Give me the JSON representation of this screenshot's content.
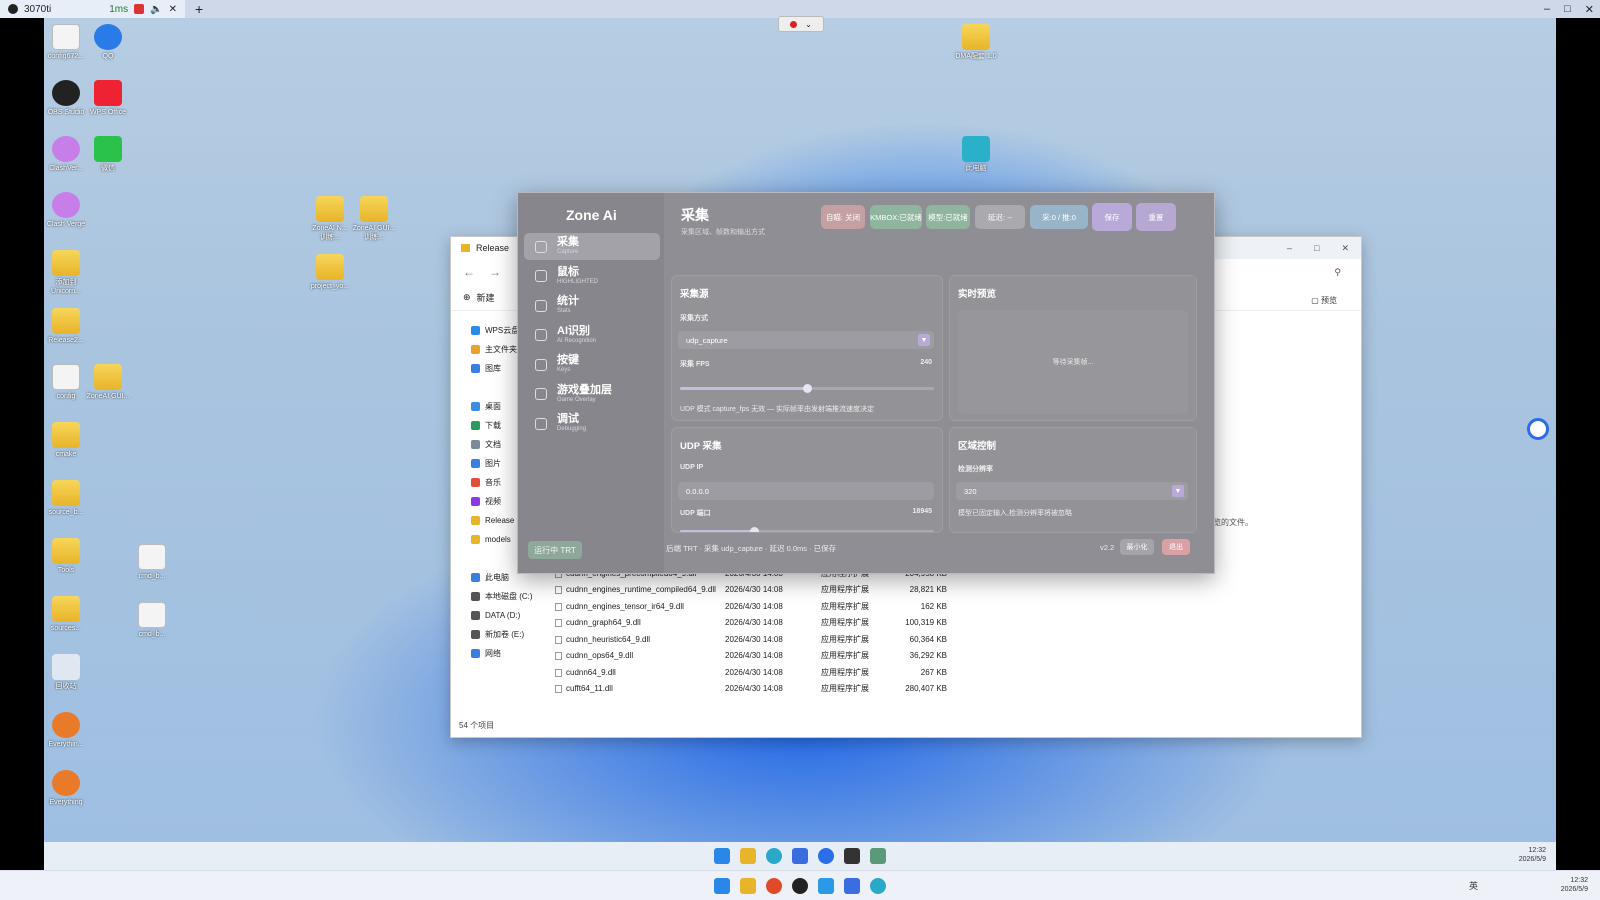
{
  "host": {
    "tab_title": "3070ti",
    "ping": "1ms",
    "taskbar_time": "12:32",
    "taskbar_date": "2026/5/9",
    "ime": "英"
  },
  "desktop": {
    "icons": [
      "config672...",
      "QQ",
      "OBS Studio",
      "WPS Office",
      "ClashVer...",
      "微信",
      "Clash Verge",
      "添加到 Unicorn...",
      "Release2...",
      "config",
      "ZoneAI GUI...",
      "cmake",
      "source_b...",
      "Tools",
      "sources...",
      "回收站",
      "Everythin...",
      "Everything",
      "ZoneAI N... 训练...",
      "ZoneAI GUI... 训练...",
      "project_yo...",
      "cmd_b...",
      "cmd_b...",
      "DMA配套 1.0",
      "此电脑"
    ]
  },
  "explorer": {
    "tab": "Release",
    "new_button": "新建",
    "preview_button": "预览",
    "preview_text": "选择要预览的文件。",
    "status": "54 个项目",
    "sidebar": [
      {
        "label": "WPS云盘",
        "color": "#2a8be8"
      },
      {
        "label": "主文件夹",
        "color": "#e8a22a"
      },
      {
        "label": "图库",
        "color": "#3a7ee0"
      },
      {
        "label": "桌面",
        "color": "#3a8ee0"
      },
      {
        "label": "下载",
        "color": "#2a9a5a"
      },
      {
        "label": "文档",
        "color": "#7a8a9a"
      },
      {
        "label": "图片",
        "color": "#3a7ee0"
      },
      {
        "label": "音乐",
        "color": "#e0503a"
      },
      {
        "label": "视频",
        "color": "#8a3ae0"
      },
      {
        "label": "Release",
        "color": "#e8b429"
      },
      {
        "label": "models",
        "color": "#e8b429"
      },
      {
        "label": "此电脑",
        "color": "#3a7ee0"
      },
      {
        "label": "本地磁盘 (C:)",
        "color": "#555"
      },
      {
        "label": "DATA (D:)",
        "color": "#555"
      },
      {
        "label": "新加卷 (E:)",
        "color": "#555"
      },
      {
        "label": "网络",
        "color": "#3a7ee0"
      }
    ],
    "files": [
      {
        "name": "cudnn_engines_precompiled64_9.dll",
        "date": "2026/4/30 14:08",
        "type": "应用程序扩展",
        "size": "204,958 KB"
      },
      {
        "name": "cudnn_engines_runtime_compiled64_9.dll",
        "date": "2026/4/30 14:08",
        "type": "应用程序扩展",
        "size": "28,821 KB"
      },
      {
        "name": "cudnn_engines_tensor_ir64_9.dll",
        "date": "2026/4/30 14:08",
        "type": "应用程序扩展",
        "size": "162 KB"
      },
      {
        "name": "cudnn_graph64_9.dll",
        "date": "2026/4/30 14:08",
        "type": "应用程序扩展",
        "size": "100,319 KB"
      },
      {
        "name": "cudnn_heuristic64_9.dll",
        "date": "2026/4/30 14:08",
        "type": "应用程序扩展",
        "size": "60,364 KB"
      },
      {
        "name": "cudnn_ops64_9.dll",
        "date": "2026/4/30 14:08",
        "type": "应用程序扩展",
        "size": "36,292 KB"
      },
      {
        "name": "cudnn64_9.dll",
        "date": "2026/4/30 14:08",
        "type": "应用程序扩展",
        "size": "267 KB"
      },
      {
        "name": "cufft64_11.dll",
        "date": "2026/4/30 14:08",
        "type": "应用程序扩展",
        "size": "280,407 KB"
      }
    ]
  },
  "zone": {
    "brand": "Zone Ai",
    "nav": [
      {
        "label": "采集",
        "sub": "Capture"
      },
      {
        "label": "鼠标",
        "sub": "HIGHLIGHTED"
      },
      {
        "label": "统计",
        "sub": "Stats"
      },
      {
        "label": "AI识别",
        "sub": "AI Recognition"
      },
      {
        "label": "按键",
        "sub": "Keys"
      },
      {
        "label": "游戏叠加层",
        "sub": "Game Overlay"
      },
      {
        "label": "调试",
        "sub": "Debugging"
      }
    ],
    "trt_button": "运行中 TRT",
    "page_title": "采集",
    "page_sub": "采集区域、帧数和输出方式",
    "chips": [
      {
        "label": "自瞄: 关闭",
        "color": "#c4a0a3"
      },
      {
        "label": "KMBOX:已就绪",
        "color": "#8fb59e"
      },
      {
        "label": "模型:已就绪",
        "color": "#8fb59e"
      },
      {
        "label": "延迟: --",
        "color": "#a9a9ae"
      },
      {
        "label": "采:0 / 推:0",
        "color": "#97b4c8"
      },
      {
        "label": "保存",
        "color": "#b9a9d8"
      },
      {
        "label": "重置",
        "color": "#b6a8d2"
      }
    ],
    "capture_source": {
      "title": "采集源",
      "method_label": "采集方式",
      "method_value": "udp_capture",
      "fps_label": "采集 FPS",
      "fps_value": "240",
      "fps_fraction": 0.5,
      "note": "UDP 模式 capture_fps 无效 — 实际帧率由发射端推流速度决定"
    },
    "preview": {
      "title": "实时预览",
      "waiting": "等待采集帧..."
    },
    "udp": {
      "title": "UDP 采集",
      "ip_label": "UDP IP",
      "ip_value": "0.0.0.0",
      "port_label": "UDP 端口",
      "port_value": "18945",
      "port_fraction": 0.29
    },
    "region": {
      "title": "区域控制",
      "res_label": "检测分辨率",
      "res_value": "320",
      "note": "模型已固定输入,检测分辨率将被忽略"
    },
    "footer": "后端 TRT · 采集 udp_capture · 延迟 0.0ms · 已保存",
    "version": "v2.2",
    "min_button": "最小化",
    "exit_button": "退出"
  },
  "remote_tray": {
    "time": "12:32",
    "date": "2026/5/9"
  }
}
